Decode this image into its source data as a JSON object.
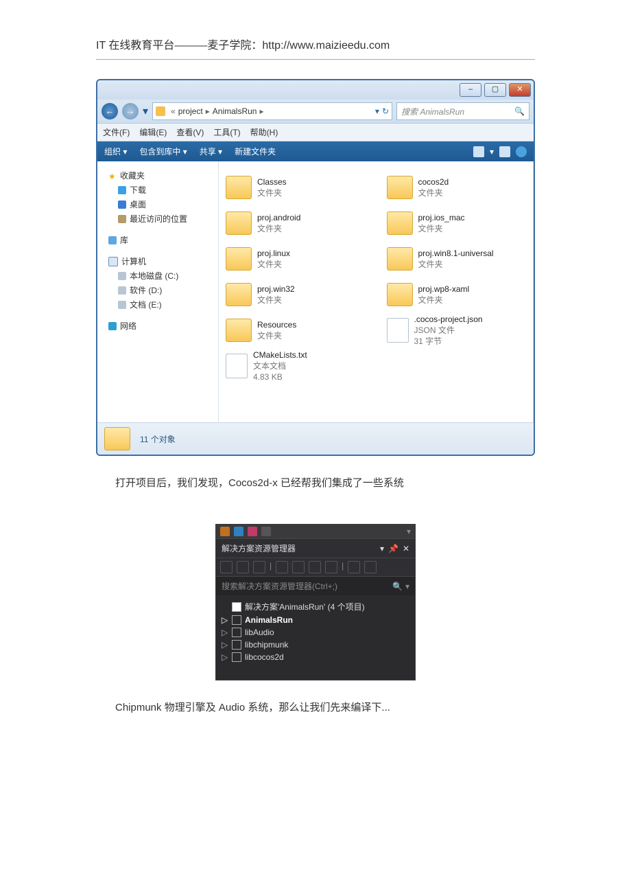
{
  "header": {
    "text": "IT 在线教育平台———麦子学院：http://www.maizieedu.com"
  },
  "explorer": {
    "breadcrumb": {
      "prefix": "«",
      "part1": "project",
      "part2": "AnimalsRun"
    },
    "search": {
      "placeholder": "搜索 AnimalsRun"
    },
    "menubar": [
      "文件(F)",
      "编辑(E)",
      "查看(V)",
      "工具(T)",
      "帮助(H)"
    ],
    "toolbar": {
      "organize": "组织 ▾",
      "include": "包含到库中 ▾",
      "share": "共享 ▾",
      "newfolder": "新建文件夹"
    },
    "sidebar": {
      "fav": {
        "label": "收藏夹"
      },
      "down": {
        "label": "下载"
      },
      "desk": {
        "label": "桌面"
      },
      "recent": {
        "label": "最近访问的位置"
      },
      "lib": {
        "label": "库"
      },
      "comp": {
        "label": "计算机"
      },
      "c": {
        "label": "本地磁盘 (C:)"
      },
      "d": {
        "label": "软件 (D:)"
      },
      "e": {
        "label": "文档 (E:)"
      },
      "net": {
        "label": "网络"
      }
    },
    "files": [
      {
        "name": "Classes",
        "type": "文件夹",
        "kind": "folder"
      },
      {
        "name": "cocos2d",
        "type": "文件夹",
        "kind": "folder"
      },
      {
        "name": "proj.android",
        "type": "文件夹",
        "kind": "folder"
      },
      {
        "name": "proj.ios_mac",
        "type": "文件夹",
        "kind": "folder"
      },
      {
        "name": "proj.linux",
        "type": "文件夹",
        "kind": "folder"
      },
      {
        "name": "proj.win8.1-universal",
        "type": "文件夹",
        "kind": "folder"
      },
      {
        "name": "proj.win32",
        "type": "文件夹",
        "kind": "folder"
      },
      {
        "name": "proj.wp8-xaml",
        "type": "文件夹",
        "kind": "folder"
      },
      {
        "name": "Resources",
        "type": "文件夹",
        "kind": "folder"
      },
      {
        "name": ".cocos-project.json",
        "type": "JSON 文件",
        "size": "31 字节",
        "kind": "file"
      },
      {
        "name": "CMakeLists.txt",
        "type": "文本文档",
        "size": "4.83 KB",
        "kind": "file"
      }
    ],
    "status": {
      "count": "11 个对象"
    }
  },
  "p1": "打开项目后，我们发现，Cocos2d-x 已经帮我们集成了一些系统",
  "vs": {
    "title": "解决方案资源管理器",
    "search": "搜索解决方案资源管理器(Ctrl+;)",
    "solution": "解决方案'AnimalsRun' (4 个项目)",
    "projects": [
      "AnimalsRun",
      "libAudio",
      "libchipmunk",
      "libcocos2d"
    ]
  },
  "p2": "Chipmunk 物理引擎及 Audio 系统，那么让我们先来编译下..."
}
